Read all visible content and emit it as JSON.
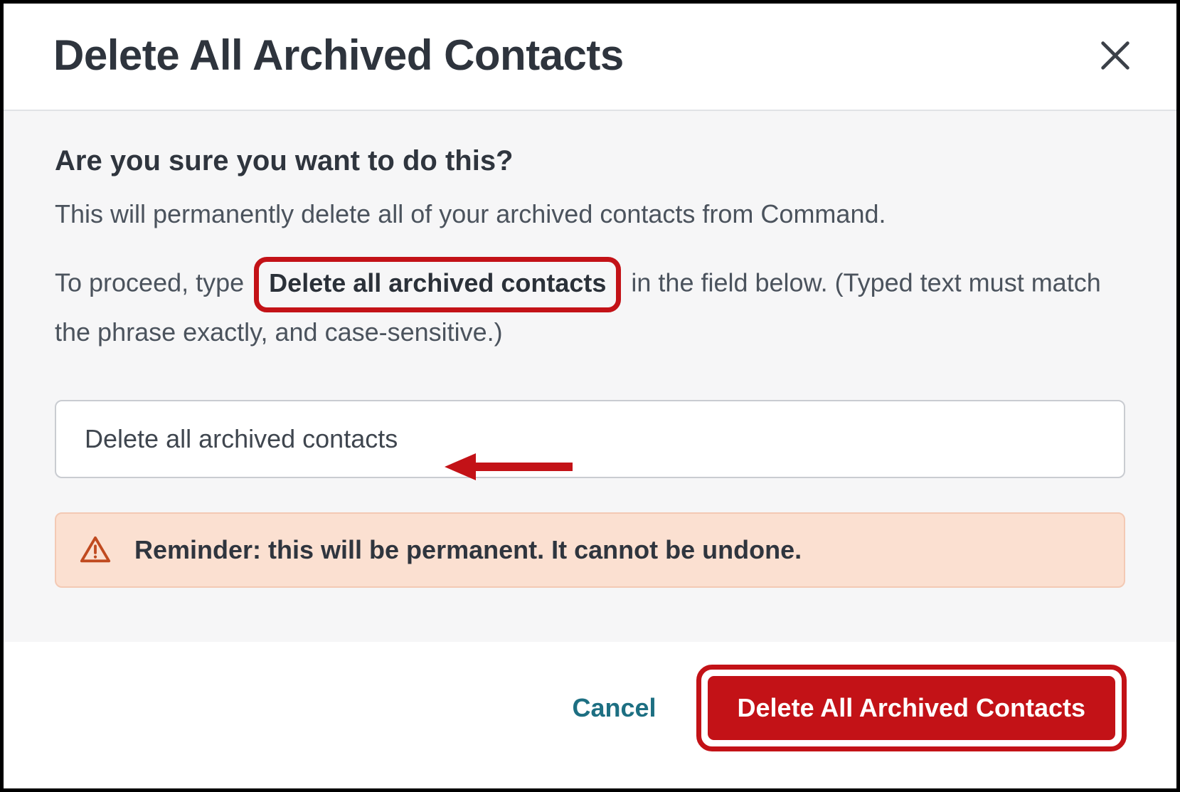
{
  "modal": {
    "title": "Delete All Archived Contacts",
    "heading": "Are you sure you want to do this?",
    "warning_line": "This will permanently delete all of your archived contacts from Command.",
    "instr_pre": "To proceed, type ",
    "phrase": "Delete all archived contacts",
    "instr_post": " in the field below. (Typed text must match the phrase exactly, and case-sensitive.)",
    "input_value": "Delete all archived contacts",
    "reminder": "Reminder: this will be permanent. It cannot be undone.",
    "cancel_label": "Cancel",
    "confirm_label": "Delete All Archived Contacts"
  },
  "colors": {
    "danger": "#c31217",
    "teal": "#1d6f82",
    "body_bg": "#f6f6f7",
    "warn_bg": "#fbe0d1"
  }
}
